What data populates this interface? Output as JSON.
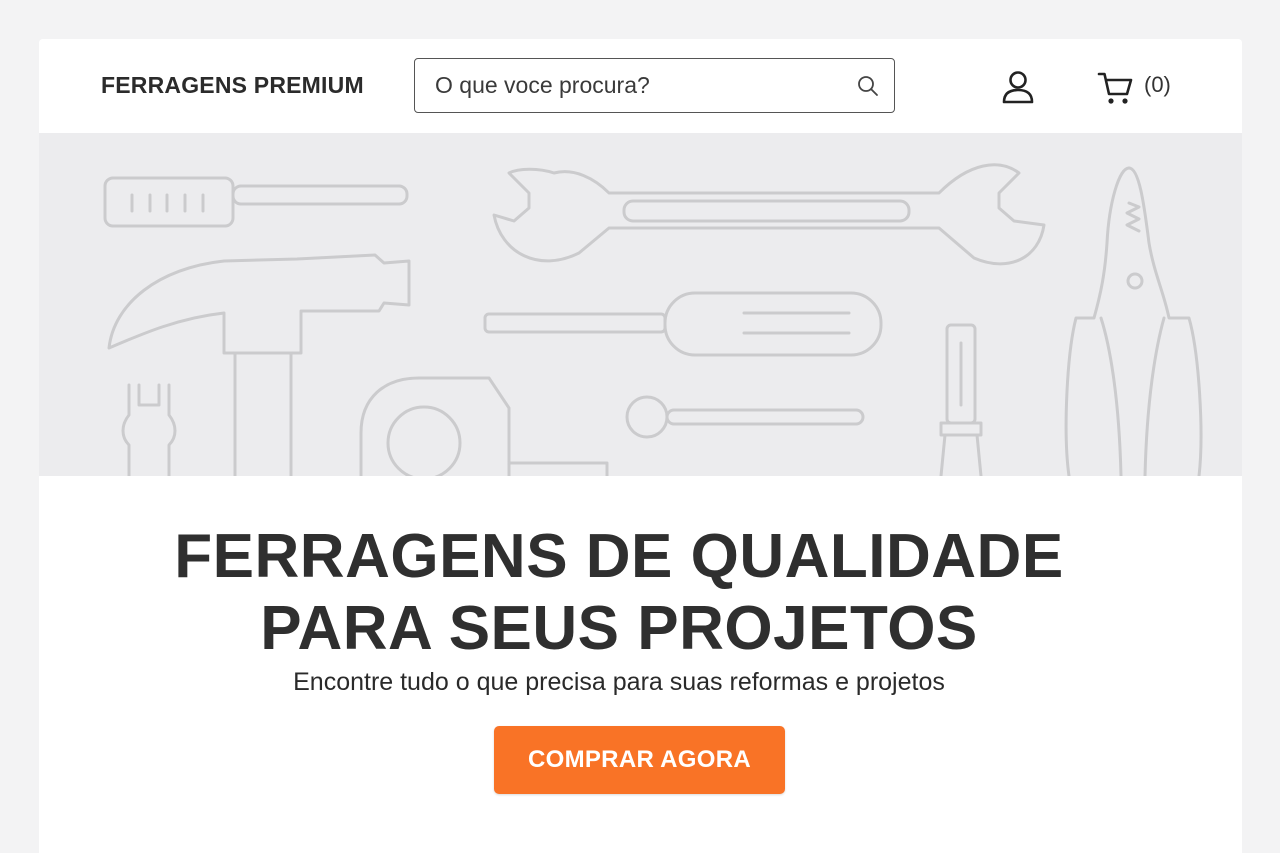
{
  "header": {
    "brand": "FERRAGENS PREMIUM",
    "search": {
      "placeholder": "O que voce procura?",
      "icon": "search-icon"
    },
    "account_icon": "user-icon",
    "cart": {
      "icon": "cart-icon",
      "count_label": "(0)"
    }
  },
  "hero": {
    "background_illustration": "tools-outline-pattern",
    "headline_line1": "FERRAGENS DE QUALIDADE",
    "headline_line2": "PARA SEUS PROJETOS",
    "subheadline": "Encontre tudo o que precisa para suas reformas e projetos",
    "cta_label": "COMPRAR AGORA"
  },
  "colors": {
    "accent": "#f97326",
    "text": "#2f2f2f",
    "hero_band": "#ececee",
    "page_background": "#f3f3f4"
  }
}
